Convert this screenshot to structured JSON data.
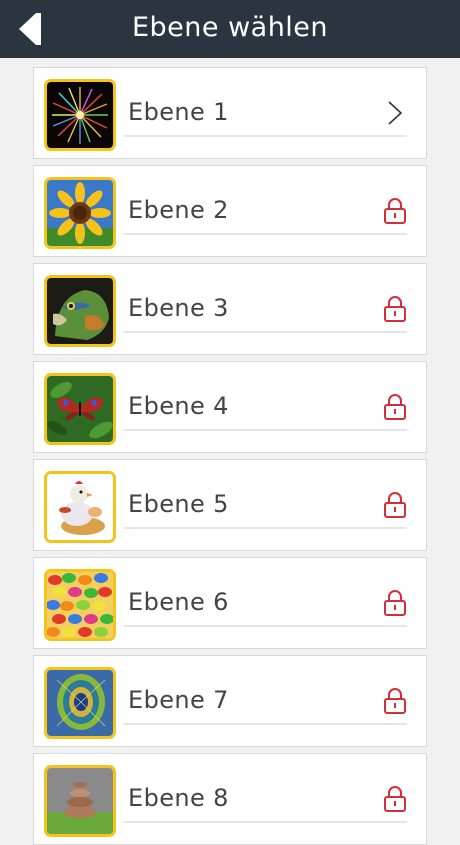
{
  "header": {
    "title": "Ebene wählen",
    "back_icon": "back-arrow-icon"
  },
  "levels": [
    {
      "label": "Ebene 1",
      "thumbnail": "fireworks",
      "status_icon": "chevron-right-icon",
      "locked": false
    },
    {
      "label": "Ebene 2",
      "thumbnail": "sunflower",
      "status_icon": "lock-icon",
      "locked": true
    },
    {
      "label": "Ebene 3",
      "thumbnail": "parrot",
      "status_icon": "lock-icon",
      "locked": true
    },
    {
      "label": "Ebene 4",
      "thumbnail": "butterfly",
      "status_icon": "lock-icon",
      "locked": true
    },
    {
      "label": "Ebene 5",
      "thumbnail": "chicken-figurine",
      "status_icon": "lock-icon",
      "locked": true
    },
    {
      "label": "Ebene 6",
      "thumbnail": "jelly-beans",
      "status_icon": "lock-icon",
      "locked": true
    },
    {
      "label": "Ebene 7",
      "thumbnail": "peacock-feather",
      "status_icon": "lock-icon",
      "locked": true
    },
    {
      "label": "Ebene 8",
      "thumbnail": "stacked-stones",
      "status_icon": "lock-icon",
      "locked": true
    }
  ],
  "colors": {
    "header_bg": "#2b3540",
    "lock": "#d32f3a",
    "thumb_border": "#f5c41a"
  }
}
